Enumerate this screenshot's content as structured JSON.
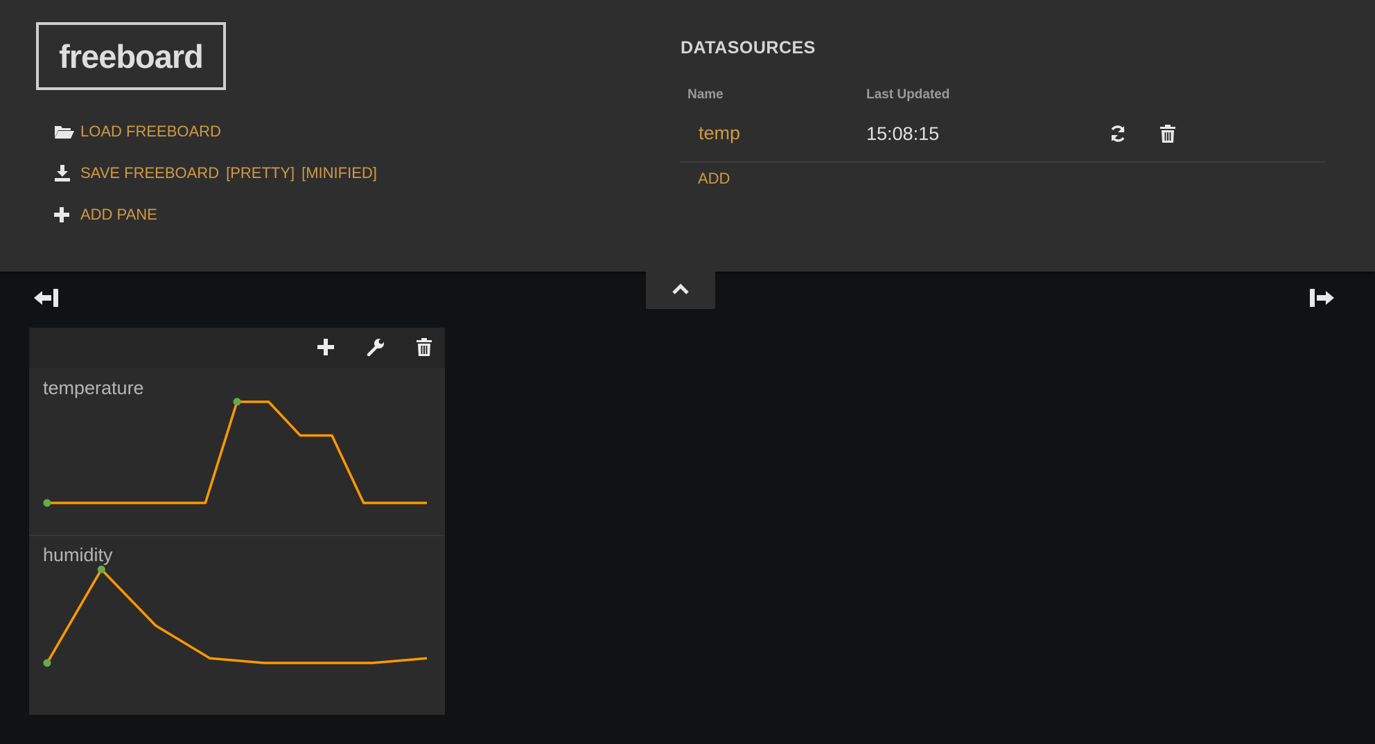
{
  "brand": {
    "logo": "freeboard"
  },
  "menu": {
    "load": "LOAD FREEBOARD",
    "save": "SAVE FREEBOARD",
    "save_pretty": "[PRETTY]",
    "save_minified": "[MINIFIED]",
    "add_pane": "ADD PANE"
  },
  "datasources": {
    "title": "DATASOURCES",
    "columns": {
      "name": "Name",
      "last_updated": "Last Updated"
    },
    "rows": [
      {
        "name": "temp",
        "last_updated": "15:08:15"
      }
    ],
    "add_label": "ADD"
  },
  "icons": {
    "load": "folder-open-icon",
    "save": "download-icon",
    "add_pane": "plus-icon",
    "refresh": "refresh-icon",
    "delete": "trash-icon",
    "toggle": "chevron-up-icon",
    "shrink": "arrow-left-collapse-icon",
    "expand": "arrow-right-expand-icon",
    "pane_add": "plus-icon",
    "pane_settings": "wrench-icon",
    "pane_delete": "trash-icon"
  },
  "colors": {
    "accent": "#d19a42",
    "line": "#ff9900",
    "spot": "#6aa84f",
    "header_bg": "#2e2e2e",
    "page_bg": "#101214"
  },
  "widgets": [
    {
      "title": "temperature",
      "values": [
        0,
        0,
        0,
        0,
        0,
        0,
        3,
        3,
        2,
        2,
        0,
        0,
        0
      ]
    },
    {
      "title": "humidity",
      "values": [
        0,
        10,
        4,
        0.5,
        0,
        0,
        0,
        0.5
      ]
    }
  ]
}
